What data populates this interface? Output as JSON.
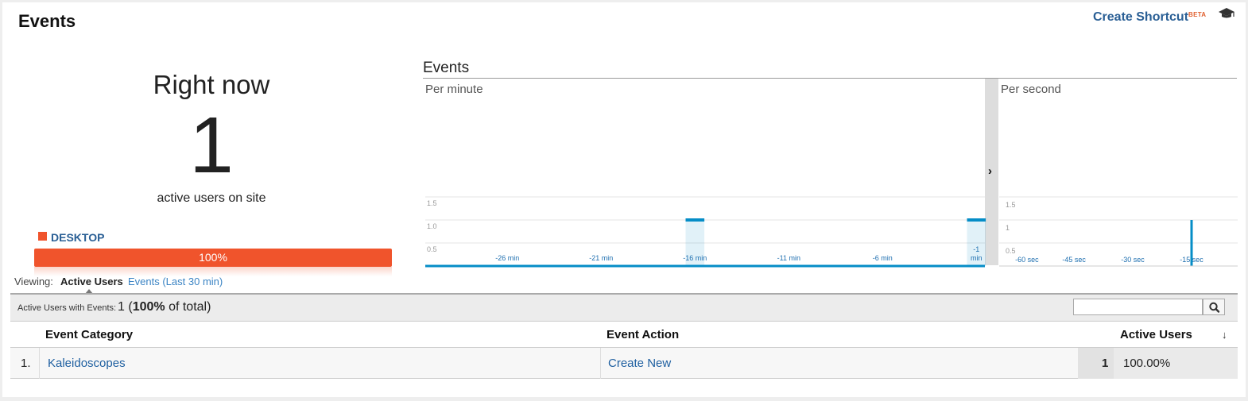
{
  "header": {
    "title": "Events",
    "shortcut_label": "Create Shortcut",
    "beta_label": "BETA",
    "education_icon": "graduation-cap-icon"
  },
  "right_now": {
    "title": "Right now",
    "count": "1",
    "subtitle": "active users on site",
    "device_label": "DESKTOP",
    "device_percent_label": "100%",
    "device_share": 1.0,
    "device_color": "#f0542c"
  },
  "viewing": {
    "label": "Viewing:",
    "tabs": [
      {
        "label": "Active Users",
        "active": true
      },
      {
        "label": "Events (Last 30 min)",
        "active": false
      }
    ]
  },
  "chart_data": [
    {
      "type": "bar",
      "title": "Events",
      "subtitle": "Per minute",
      "x_tick_labels": [
        "-26 min",
        "-21 min",
        "-16 min",
        "-11 min",
        "-6 min",
        "-1 min"
      ],
      "x": [
        -30,
        -29,
        -28,
        -27,
        -26,
        -25,
        -24,
        -23,
        -22,
        -21,
        -20,
        -19,
        -18,
        -17,
        -16,
        -15,
        -14,
        -13,
        -12,
        -11,
        -10,
        -9,
        -8,
        -7,
        -6,
        -5,
        -4,
        -3,
        -2,
        -1
      ],
      "values": [
        0,
        0,
        0,
        0,
        0,
        0,
        0,
        0,
        0,
        0,
        0,
        0,
        0,
        0,
        1,
        0,
        0,
        0,
        0,
        0,
        0,
        0,
        0,
        0,
        0,
        0,
        0,
        0,
        0,
        1
      ],
      "y_tick_labels": [
        "0.5",
        "1.0",
        "1.5"
      ],
      "ylim": [
        0,
        2
      ],
      "grid": true,
      "color": "#058dc7"
    },
    {
      "type": "bar",
      "subtitle": "Per second",
      "x_tick_labels": [
        "-60 sec",
        "-45 sec",
        "-30 sec",
        "-15 sec"
      ],
      "x": [
        -60,
        -15
      ],
      "values": [
        0,
        1
      ],
      "y_tick_labels": [
        "0.5",
        "1",
        "1.5"
      ],
      "ylim": [
        0,
        2
      ],
      "grid": true,
      "color": "#058dc7"
    }
  ],
  "table": {
    "summary_label": "Active Users with Events:",
    "summary_count": "1",
    "summary_pct": "100%",
    "summary_suffix": "of total)",
    "search_placeholder": "",
    "search_icon": "search-icon",
    "columns": [
      "Event Category",
      "Event Action",
      "Active Users"
    ],
    "rows": [
      {
        "index": "1.",
        "category": "Kaleidoscopes",
        "action": "Create New",
        "users": "1",
        "percent": "100.00%"
      }
    ]
  }
}
